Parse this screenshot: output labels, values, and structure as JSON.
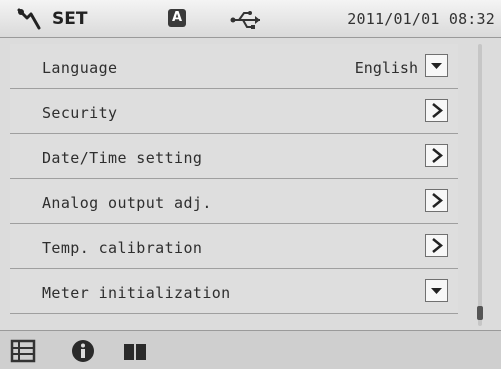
{
  "header": {
    "title": "SET",
    "mode_badge": "A",
    "datetime": "2011/01/01 08:32",
    "icons": [
      "wrench-icon",
      "usb-icon"
    ]
  },
  "menu": {
    "items": [
      {
        "label": "Language",
        "value": "English",
        "control": "dropdown"
      },
      {
        "label": "Security",
        "control": "arrow"
      },
      {
        "label": "Date/Time setting",
        "control": "arrow"
      },
      {
        "label": "Analog output adj.",
        "control": "arrow"
      },
      {
        "label": "Temp. calibration",
        "control": "arrow"
      },
      {
        "label": "Meter initialization",
        "control": "dropdown"
      }
    ]
  },
  "scrollbar": {
    "position": "bottom"
  },
  "bottombar": {
    "icons": [
      "list-icon",
      "info-icon",
      "book-icon"
    ]
  }
}
